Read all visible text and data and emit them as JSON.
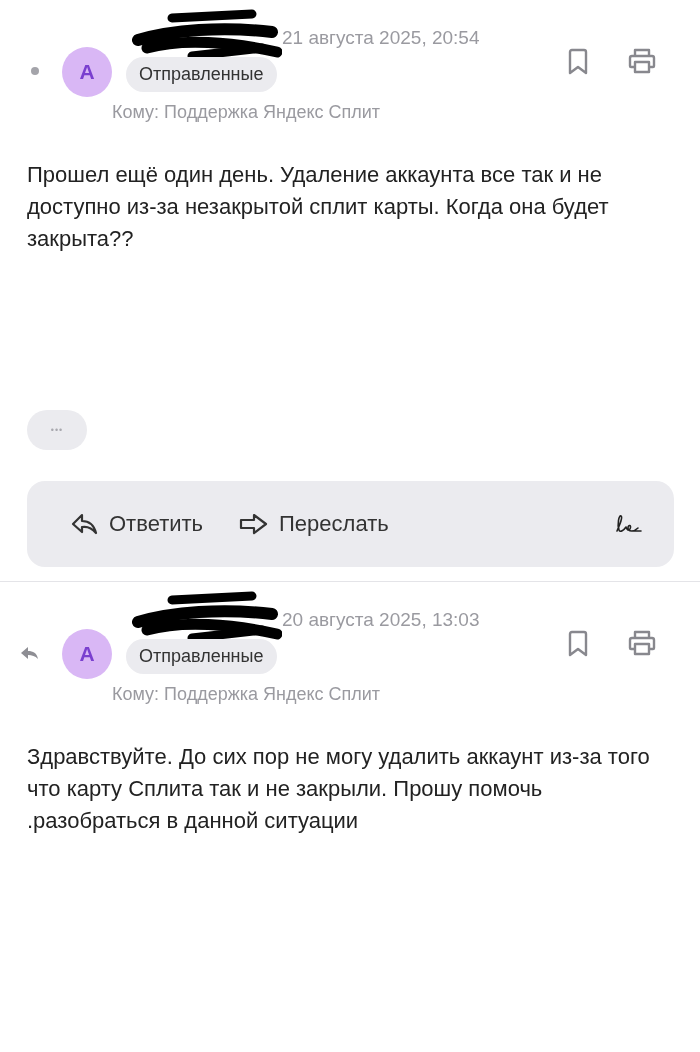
{
  "messages": [
    {
      "kind": "unread",
      "avatar": "А",
      "date": "21 августа 2025, 20:54",
      "folder": "Отправленные",
      "recipient": "Кому: Поддержка Яндекс Сплит",
      "body": "Прошел ещё один день. Удаление аккаунта все так и не доступно из-за незакрытой сплит карты. Когда она будет закрыта??",
      "more": "•••",
      "actions": [
        {
          "kind": "reply",
          "label": "Ответить"
        },
        {
          "kind": "forward",
          "label": "Переслать"
        },
        {
          "kind": "signature"
        }
      ]
    },
    {
      "kind": "replied",
      "avatar": "А",
      "date": "20 августа 2025, 13:03",
      "folder": "Отправленные",
      "recipient": "Кому: Поддержка Яндекс Сплит",
      "body": "Здравствуйте. До сих пор не могу удалить аккаунт из-за того что карту Сплита так и не закрыли. Прошу помочь .разобраться в данной ситуации"
    }
  ]
}
